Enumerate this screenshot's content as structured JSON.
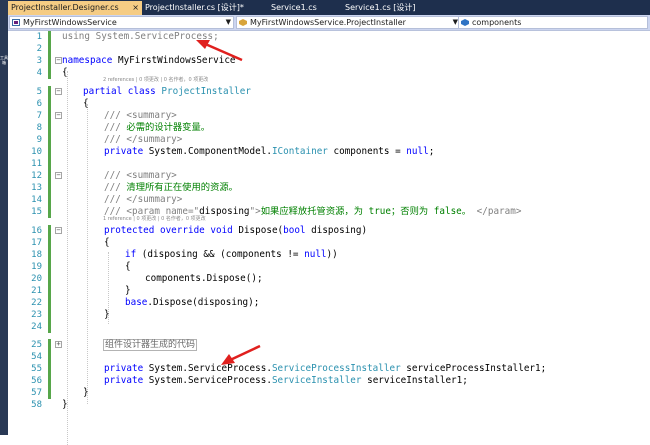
{
  "tabs": [
    {
      "label": "ProjectInstaller.Designer.cs",
      "active": true,
      "closable": true
    },
    {
      "label": "ProjectInstaller.cs [设计]*",
      "active": false
    },
    {
      "label": "Service1.cs",
      "active": false
    },
    {
      "label": "Service1.cs [设计]",
      "active": false
    }
  ],
  "close_glyph": "×",
  "navigation": {
    "project": "MyFirstWindowsService",
    "class": "MyFirstWindowsService.ProjectInstaller",
    "member": "components"
  },
  "sidebar_text": "工具箱",
  "code_lens": {
    "namespace": "2 references | 0 项更改 | 0 名作者，0 项更改",
    "dispose": "1 reference | 0 项更改 | 0 名作者，0 项更改"
  },
  "line_numbers": [
    "1",
    "2",
    "3",
    "4",
    "5",
    "6",
    "7",
    "8",
    "9",
    "10",
    "11",
    "12",
    "13",
    "14",
    "15",
    "16",
    "17",
    "18",
    "19",
    "20",
    "21",
    "22",
    "23",
    "24",
    "25",
    "54",
    "55",
    "56",
    "57",
    "58"
  ],
  "code": {
    "l1_using": "using",
    "l1_ns": " System.ServiceProcess;",
    "l3_kw": "namespace",
    "l3_name": " MyFirstWindowsService",
    "l4": "{",
    "l5_kw1": "partial",
    "l5_kw2": "class",
    "l5_type": "ProjectInstaller",
    "l6": "{",
    "l7": "/// <summary>",
    "l8_slash": "/// ",
    "l8_text": "必需的设计器变量。",
    "l9": "/// </summary>",
    "l10_kw": "private",
    "l10_ns": " System.ComponentModel.",
    "l10_type": "IContainer",
    "l10_rest": " components = ",
    "l10_null": "null",
    "l10_end": ";",
    "l12": "/// <summary>",
    "l13_slash": "/// ",
    "l13_text": "清理所有正在使用的资源。",
    "l14": "/// </summary>",
    "l15_slash": "/// <param name=\"",
    "l15_param": "disposing",
    "l15_close": "\">",
    "l15_text": "如果应释放托管资源，为 true；否则为 false。",
    "l15_end": "</param>",
    "l16_kw1": "protected",
    "l16_kw2": "override",
    "l16_kw3": "void",
    "l16_name": " Dispose(",
    "l16_kw4": "bool",
    "l16_rest": " disposing)",
    "l17": "{",
    "l18_kw": "if",
    "l18_a": " (disposing && (components != ",
    "l18_null": "null",
    "l18_b": "))",
    "l19": "{",
    "l20": "components.Dispose();",
    "l21": "}",
    "l22_kw": "base",
    "l22_rest": ".Dispose(disposing);",
    "l23": "}",
    "l25_region": "组件设计器生成的代码",
    "l55_kw": "private",
    "l55_ns": " System.ServiceProcess.",
    "l55_type": "ServiceProcessInstaller",
    "l55_rest": " serviceProcessInstaller1;",
    "l56_kw": "private",
    "l56_ns": " System.ServiceProcess.",
    "l56_type": "ServiceInstaller",
    "l56_rest": " serviceInstaller1;",
    "l57": "}",
    "l58": "}"
  },
  "colors": {
    "keyword": "#0000ff",
    "type": "#2b91af",
    "comment": "#008000",
    "annotation_arrow": "#e0201e",
    "active_tab": "#f5cc84",
    "change_bar": "#57a64a"
  }
}
